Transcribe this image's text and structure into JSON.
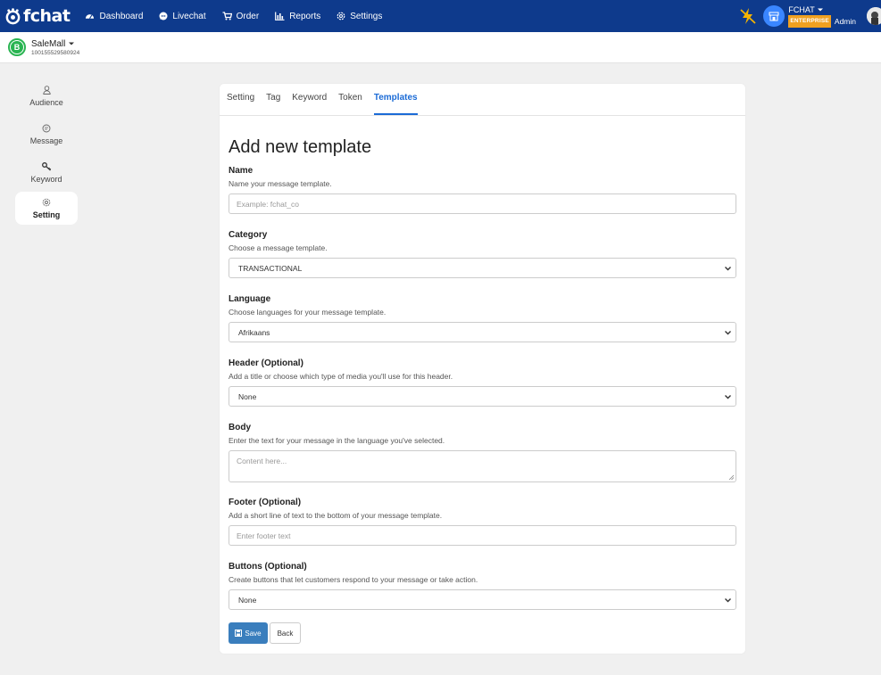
{
  "brand": {
    "name": "fchat"
  },
  "nav": {
    "items": [
      {
        "label": "Dashboard",
        "icon": "dashboard-icon"
      },
      {
        "label": "Livechat",
        "icon": "chat-icon"
      },
      {
        "label": "Order",
        "icon": "cart-icon"
      },
      {
        "label": "Reports",
        "icon": "bar-chart-icon"
      },
      {
        "label": "Settings",
        "icon": "gear-icon"
      }
    ]
  },
  "account": {
    "name": "FCHAT",
    "plan": "ENTERPRISE",
    "role": "Admin"
  },
  "page": {
    "name": "SaleMall",
    "id": "100155529580924",
    "avatar_letter": "B"
  },
  "sidebar": {
    "items": [
      {
        "label": "Audience",
        "icon": "user-icon"
      },
      {
        "label": "Message",
        "icon": "message-icon"
      },
      {
        "label": "Keyword",
        "icon": "key-icon"
      },
      {
        "label": "Setting",
        "icon": "gear-icon"
      }
    ],
    "active": "Setting"
  },
  "tabs": [
    {
      "label": "Setting"
    },
    {
      "label": "Tag"
    },
    {
      "label": "Keyword"
    },
    {
      "label": "Token"
    },
    {
      "label": "Templates"
    }
  ],
  "form": {
    "title": "Add new template",
    "name": {
      "label": "Name",
      "help": "Name your message template.",
      "placeholder": "Example: fchat_co"
    },
    "category": {
      "label": "Category",
      "help": "Choose a message template.",
      "value": "TRANSACTIONAL"
    },
    "language": {
      "label": "Language",
      "help": "Choose languages for your message template.",
      "value": "Afrikaans"
    },
    "header": {
      "label": "Header (Optional)",
      "help": "Add a title or choose which type of media you'll use for this header.",
      "value": "None"
    },
    "body": {
      "label": "Body",
      "help": "Enter the text for your message in the language you've selected.",
      "placeholder": "Content here..."
    },
    "footer": {
      "label": "Footer (Optional)",
      "help": "Add a short line of text to the bottom of your message template.",
      "placeholder": "Enter footer text"
    },
    "buttons": {
      "label": "Buttons (Optional)",
      "help": "Create buttons that let customers respond to your message or take action.",
      "value": "None"
    },
    "save_label": "Save",
    "back_label": "Back"
  },
  "colors": {
    "nav_bg": "#0e3a8c",
    "accent": "#1b6bd6",
    "save_button": "#3a7ebd",
    "page_badge": "#29b451",
    "enterprise_badge": "#f0a020"
  }
}
